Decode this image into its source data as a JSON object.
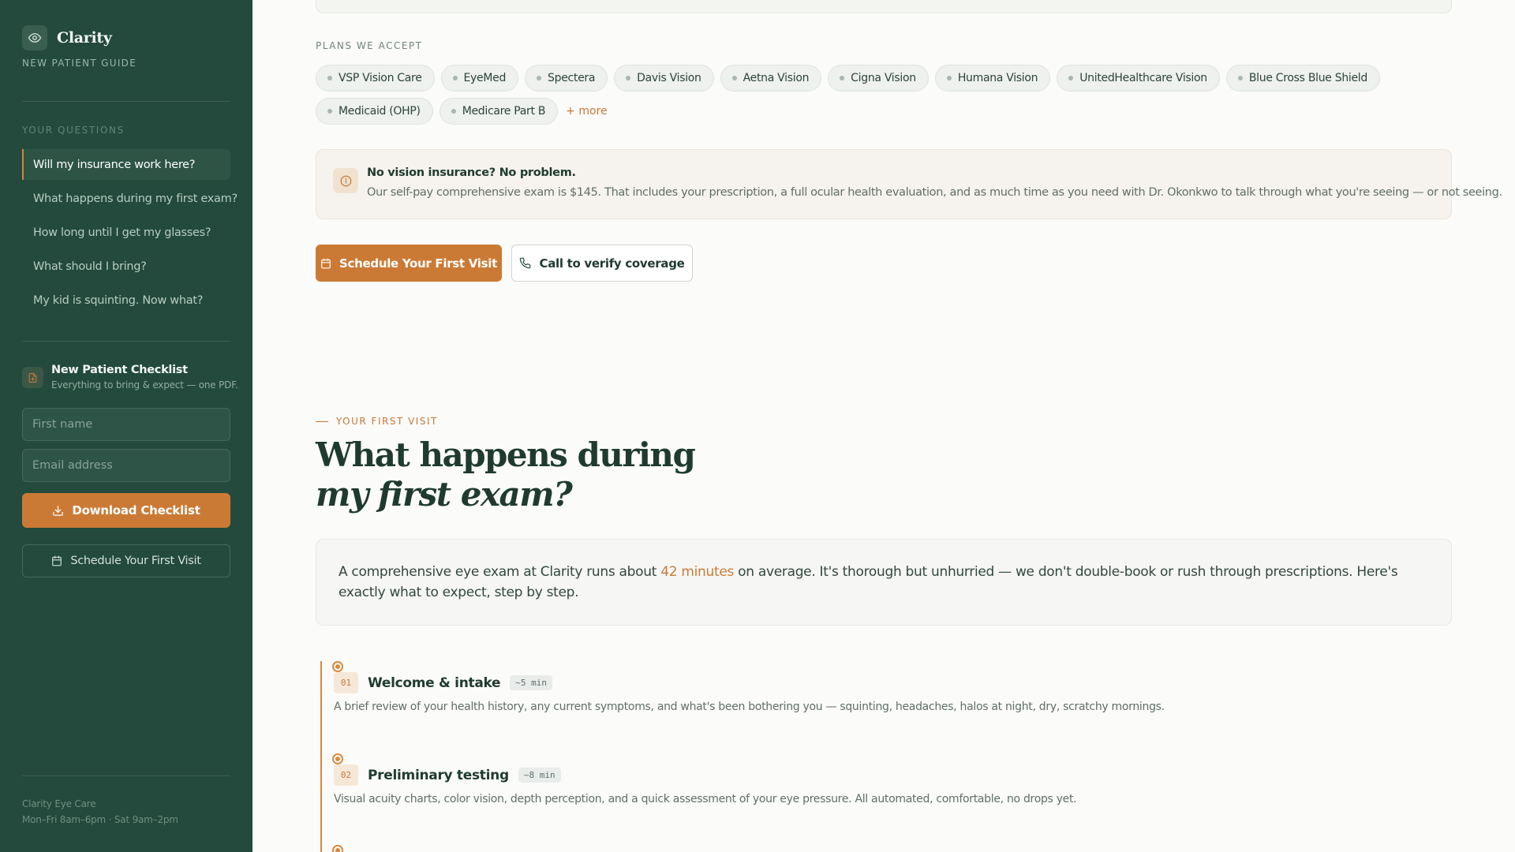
{
  "sidebar": {
    "brand_name": "Clarity",
    "brand_sub": "NEW PATIENT GUIDE",
    "questions_heading": "YOUR QUESTIONS",
    "questions": [
      {
        "label": "Will my insurance work here?",
        "active": true
      },
      {
        "label": "What happens during my first exam?",
        "active": false
      },
      {
        "label": "How long until I get my glasses?",
        "active": false
      },
      {
        "label": "What should I bring?",
        "active": false
      },
      {
        "label": "My kid is squinting. Now what?",
        "active": false
      }
    ],
    "checklist": {
      "title": "New Patient Checklist",
      "subtitle": "Everything to bring & expect — one PDF.",
      "first_name_placeholder": "First name",
      "email_placeholder": "Email address",
      "download_label": "Download Checklist",
      "schedule_label": "Schedule Your First Visit"
    },
    "footer": {
      "line1": "Clarity Eye Care",
      "line2": "Mon–Fri 8am–6pm · Sat 9am–2pm"
    }
  },
  "insurance": {
    "plans_heading": "PLANS WE ACCEPT",
    "plans": [
      "VSP Vision Care",
      "EyeMed",
      "Spectera",
      "Davis Vision",
      "Aetna Vision",
      "Cigna Vision",
      "Humana Vision",
      "UnitedHealthcare Vision",
      "Blue Cross Blue Shield",
      "Medicaid (OHP)",
      "Medicare Part B"
    ],
    "more_label": "+ more",
    "notice": {
      "title": "No vision insurance? No problem.",
      "text": "Our self-pay comprehensive exam is $145. That includes your prescription, a full ocular health evaluation, and as much time as you need with Dr. Okonkwo to talk through what you're seeing — or not seeing."
    },
    "primary_cta": "Schedule Your First Visit",
    "secondary_cta": "Call to verify coverage"
  },
  "first_visit": {
    "eyebrow": "YOUR FIRST VISIT",
    "title_line1": "What happens during",
    "title_line2": "my first exam?",
    "intro_before": "A comprehensive eye exam at Clarity runs about ",
    "intro_highlight": "42 minutes",
    "intro_after": " on average. It's thorough but unhurried — we don't double-book or rush through prescriptions. Here's exactly what to expect, step by step.",
    "steps": [
      {
        "num": "01",
        "title": "Welcome & intake",
        "duration": "~5 min",
        "desc": "A brief review of your health history, any current symptoms, and what's been bothering you — squinting, headaches, halos at night, dry, scratchy mornings."
      },
      {
        "num": "02",
        "title": "Preliminary testing",
        "duration": "~8 min",
        "desc": "Visual acuity charts, color vision, depth perception, and a quick assessment of your eye pressure. All automated, comfortable, no drops yet."
      }
    ]
  },
  "colors": {
    "sidebar_bg": "#234a3c",
    "accent": "#cb7a35",
    "text_dark": "#1f3b30"
  },
  "icons": {
    "brand": "eye-icon",
    "checklist": "document-icon",
    "download": "download-icon",
    "schedule": "calendar-icon",
    "call": "phone-icon",
    "info": "info-icon"
  }
}
